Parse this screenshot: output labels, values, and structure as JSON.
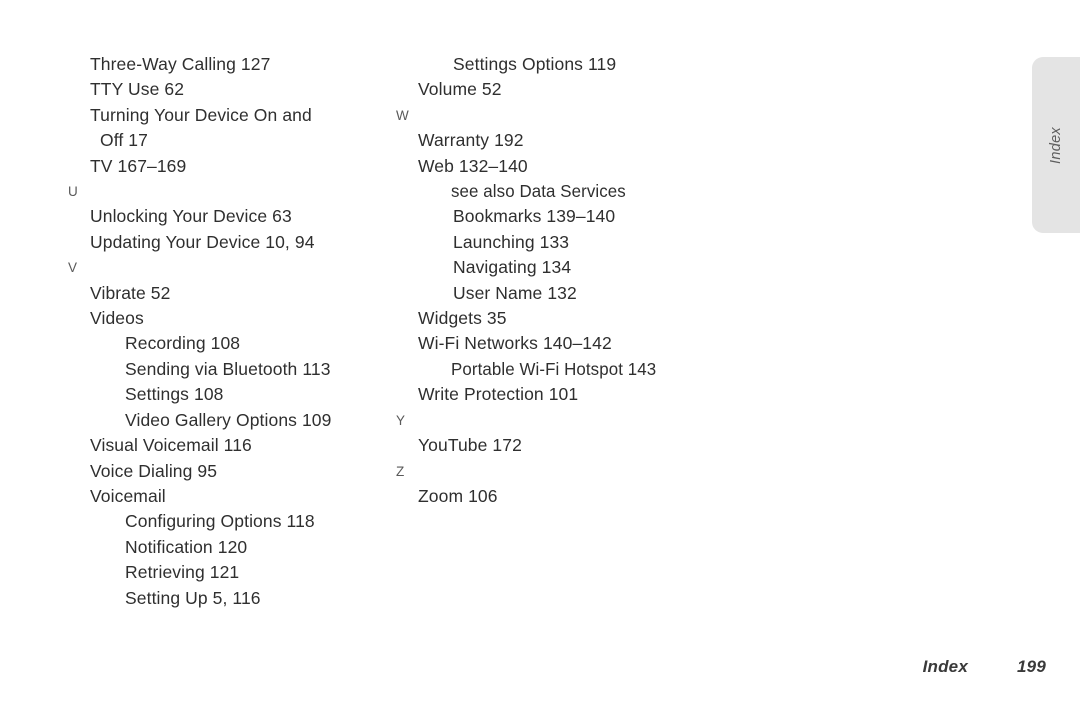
{
  "document": {
    "section_title": "Index",
    "side_tab_label": "Index",
    "footer": {
      "label": "Index",
      "page_number": "199"
    },
    "colors": {
      "text": "#2f2f2f",
      "letter_heading": "#5a5a5a",
      "side_tab_background": "#e4e4e4",
      "page_background": "#ffffff"
    }
  },
  "columns": [
    {
      "name": "left-column",
      "entries": [
        {
          "level": "main",
          "text": "Three-Way Calling 127"
        },
        {
          "level": "main",
          "text": "TTY Use 62"
        },
        {
          "level": "main",
          "text": "Turning Your Device On and"
        },
        {
          "level": "cont",
          "text": "Off 17"
        },
        {
          "level": "main",
          "text": "TV 167–169"
        },
        {
          "level": "letter",
          "text": "U"
        },
        {
          "level": "main",
          "text": "Unlocking Your Device 63"
        },
        {
          "level": "main",
          "text": "Updating Your Device 10, 94"
        },
        {
          "level": "letter",
          "text": "V"
        },
        {
          "level": "main",
          "text": "Vibrate 52"
        },
        {
          "level": "main",
          "text": "Videos"
        },
        {
          "level": "sub",
          "text": "Recording 108"
        },
        {
          "level": "sub",
          "text": "Sending via Bluetooth 113"
        },
        {
          "level": "sub",
          "text": "Settings 108"
        },
        {
          "level": "sub",
          "text": "Video Gallery Options 109"
        },
        {
          "level": "main",
          "text": "Visual Voicemail 116"
        },
        {
          "level": "main",
          "text": "Voice Dialing 95"
        },
        {
          "level": "main",
          "text": "Voicemail"
        },
        {
          "level": "sub",
          "text": "Configuring Options 118"
        },
        {
          "level": "sub",
          "text": "Notification 120"
        },
        {
          "level": "sub",
          "text": "Retrieving 121"
        },
        {
          "level": "sub",
          "text": "Setting Up 5, 116"
        }
      ]
    },
    {
      "name": "right-column",
      "entries": [
        {
          "level": "sub",
          "text": "Settings Options 119"
        },
        {
          "level": "main",
          "text": "Volume 52"
        },
        {
          "level": "letter",
          "text": "W"
        },
        {
          "level": "main",
          "text": "Warranty 192"
        },
        {
          "level": "main",
          "text": "Web 132–140"
        },
        {
          "level": "sub",
          "text": "see also Data Services",
          "condensed": true
        },
        {
          "level": "sub",
          "text": "Bookmarks 139–140"
        },
        {
          "level": "sub",
          "text": "Launching 133"
        },
        {
          "level": "sub",
          "text": "Navigating 134"
        },
        {
          "level": "sub",
          "text": "User Name 132"
        },
        {
          "level": "main",
          "text": "Widgets 35"
        },
        {
          "level": "main",
          "text": "Wi-Fi Networks 140–142"
        },
        {
          "level": "sub",
          "text": "Portable Wi-Fi Hotspot 143",
          "condensed": true
        },
        {
          "level": "main",
          "text": "Write Protection 101"
        },
        {
          "level": "letter",
          "text": "Y"
        },
        {
          "level": "main",
          "text": "YouTube 172"
        },
        {
          "level": "letter",
          "text": "Z"
        },
        {
          "level": "main",
          "text": "Zoom 106"
        }
      ]
    }
  ]
}
